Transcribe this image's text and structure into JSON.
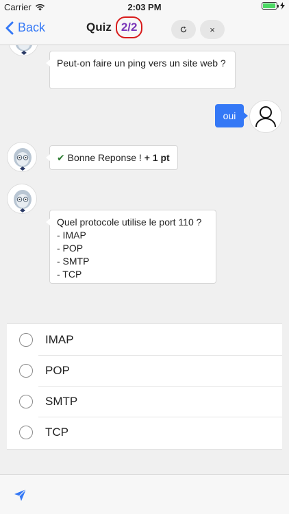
{
  "status_bar": {
    "carrier": "Carrier",
    "time": "2:03 PM",
    "battery_level": 0.95
  },
  "nav": {
    "back_label": "Back",
    "title": "Quiz",
    "counter": "2/2",
    "refresh_icon": "refresh-icon",
    "close_icon": "close-icon",
    "close_glyph": "×"
  },
  "chat": {
    "previous_question": "Peut-on faire un ping vers un site web ?",
    "user_answer": "oui",
    "feedback_text": "Bonne Reponse ! ",
    "feedback_points": "+ 1 pt",
    "current_question": "Quel protocole utilise le port 110 ?",
    "current_choices": [
      "- IMAP",
      "- POP",
      "- SMTP",
      "- TCP"
    ]
  },
  "options": [
    {
      "label": "IMAP"
    },
    {
      "label": "POP"
    },
    {
      "label": "SMTP"
    },
    {
      "label": "TCP"
    }
  ],
  "colors": {
    "accent": "#3478f6",
    "counter_text": "#7a36b8",
    "counter_ring": "#d81a1a",
    "correct": "#2e7d32"
  }
}
